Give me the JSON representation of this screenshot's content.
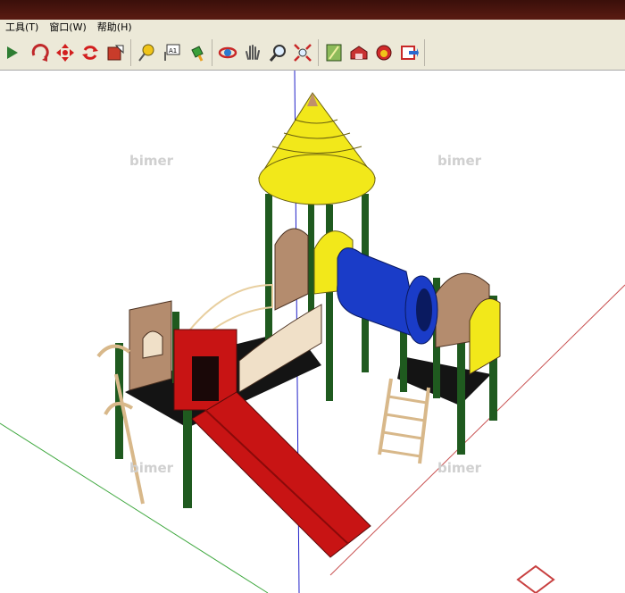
{
  "menu": {
    "items": [
      "工具(T)",
      "窗口(W)",
      "帮助(H)"
    ]
  },
  "toolbar": {
    "groups": [
      [
        "arrow-icon",
        "orbit-icon",
        "move-icon",
        "rotate-icon",
        "scale-icon"
      ],
      [
        "tape-measure-icon",
        "text-icon",
        "paint-bucket-icon"
      ],
      [
        "orbit-view-icon",
        "pan-hand-icon",
        "zoom-icon",
        "zoom-extents-icon"
      ],
      [
        "map-icon",
        "warehouse-icon",
        "component-icon",
        "share-icon"
      ]
    ]
  },
  "watermark": "bimer",
  "colors": {
    "roof": "#f2e81a",
    "post": "#1f5a1f",
    "slide": "#c81414",
    "tunnel": "#1a3cc8",
    "panel": "#b48c6e",
    "deck": "#141414",
    "rail": "#e8cfa0",
    "axis_green": "#3fa83f",
    "axis_red": "#c85050",
    "axis_blue": "#2020c8"
  }
}
